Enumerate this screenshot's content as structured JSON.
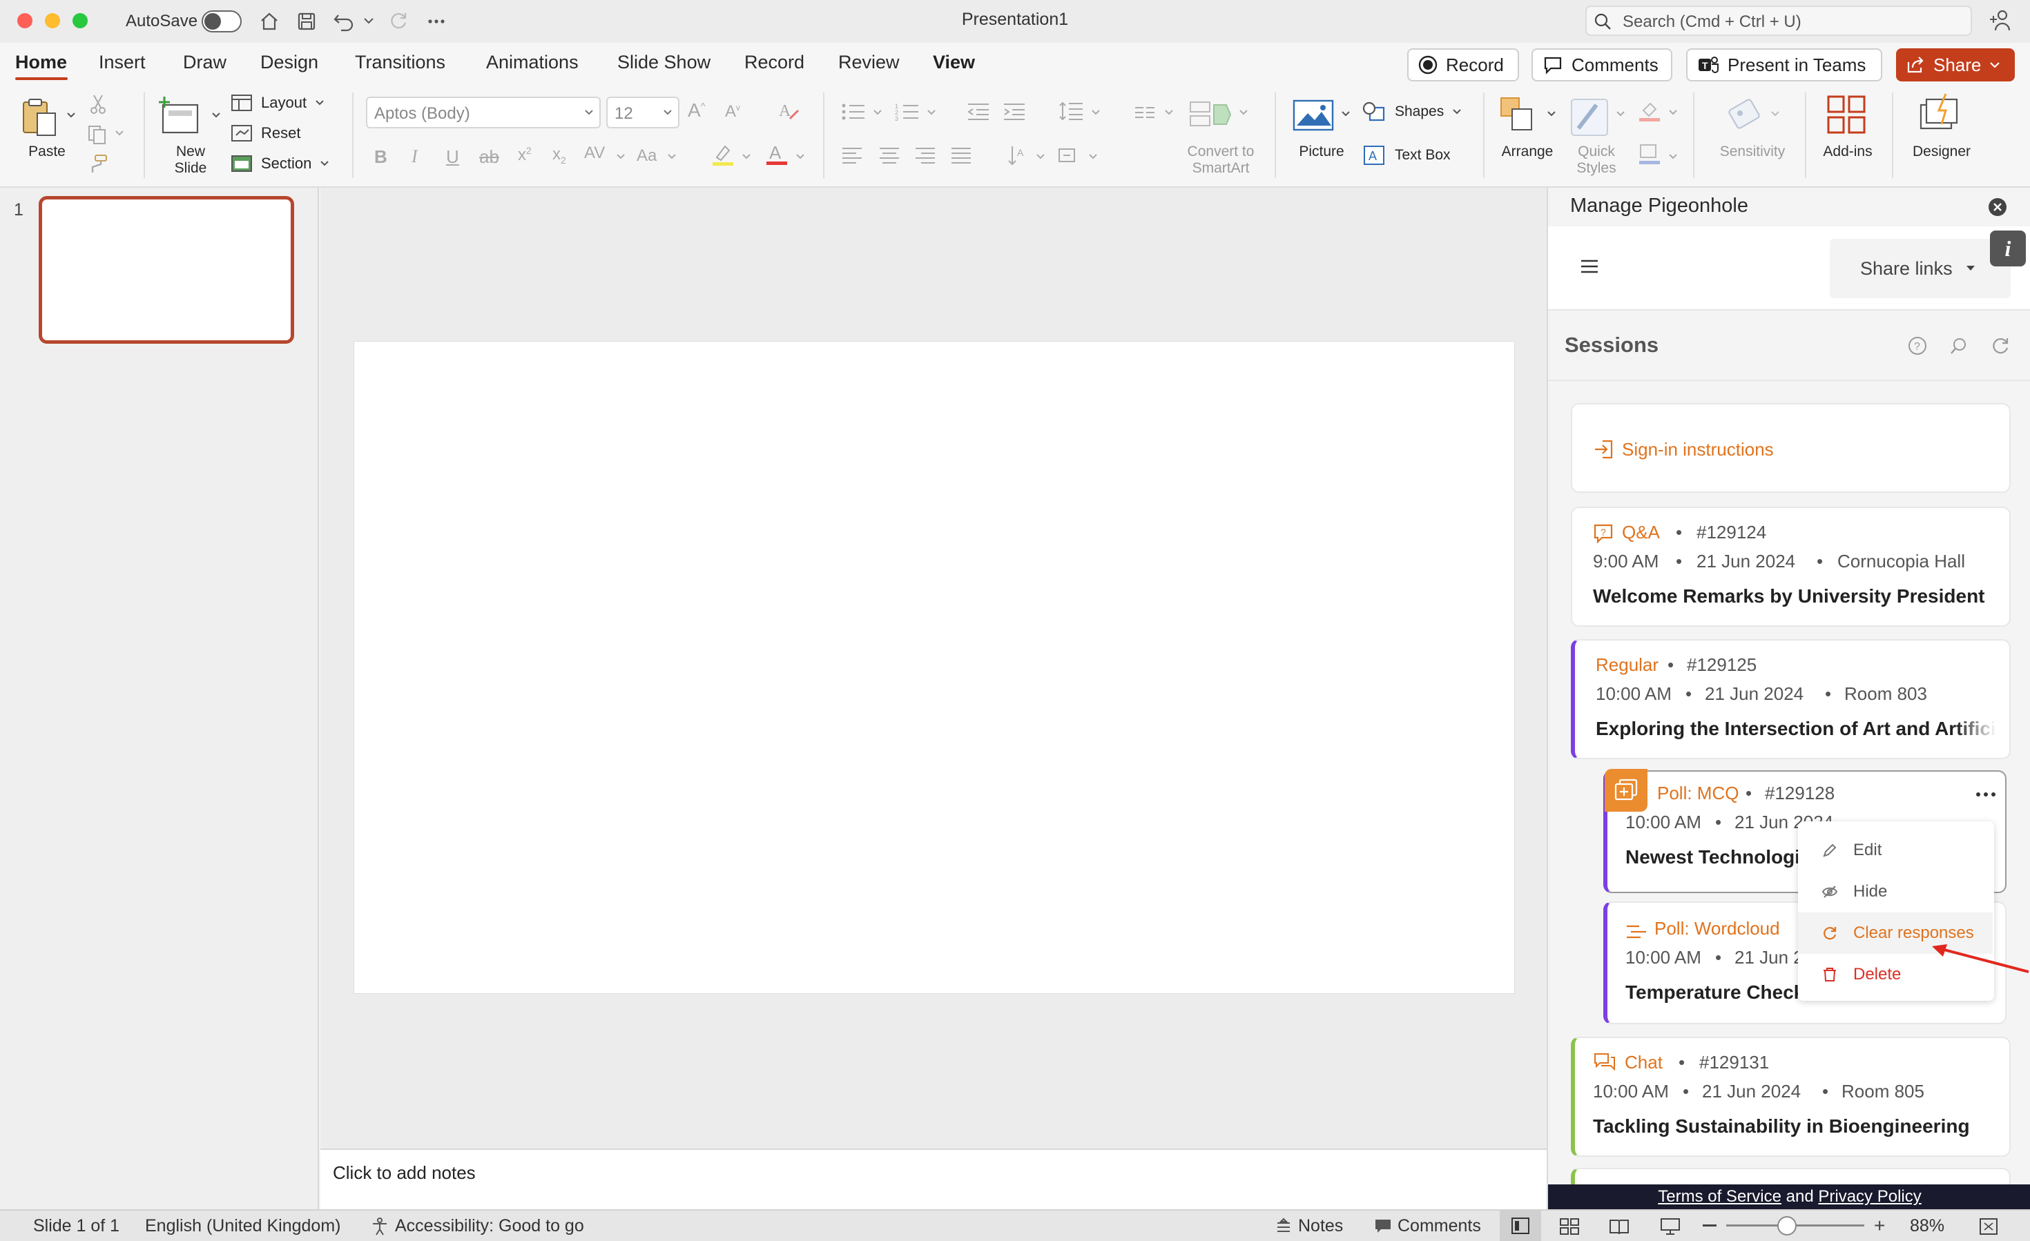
{
  "window": {
    "title": "Presentation1",
    "autosave_label": "AutoSave",
    "search_placeholder": "Search (Cmd + Ctrl + U)"
  },
  "tabs": [
    "Home",
    "Insert",
    "Draw",
    "Design",
    "Transitions",
    "Animations",
    "Slide Show",
    "Record",
    "Review",
    "View"
  ],
  "top_buttons": {
    "record": "Record",
    "comments": "Comments",
    "present": "Present in Teams",
    "share": "Share"
  },
  "ribbon": {
    "paste": "Paste",
    "new_slide_1": "New",
    "new_slide_2": "Slide",
    "layout": "Layout",
    "reset": "Reset",
    "section": "Section",
    "font_name": "Aptos (Body)",
    "font_size": "12",
    "convert_1": "Convert to",
    "convert_2": "SmartArt",
    "picture": "Picture",
    "shapes": "Shapes",
    "text_box": "Text Box",
    "arrange": "Arrange",
    "quick_1": "Quick",
    "quick_2": "Styles",
    "sensitivity": "Sensitivity",
    "addins": "Add-ins",
    "designer": "Designer",
    "accent_color": "#c43e1c"
  },
  "thumbnails": {
    "number": "1"
  },
  "notes_placeholder": "Click to add notes",
  "panel": {
    "title": "Manage Pigeonhole",
    "share_links": "Share links",
    "sessions_heading": "Sessions",
    "sign_in": "Sign-in instructions",
    "sessions": [
      {
        "type": "Q&A",
        "id": "#129124",
        "time": "9:00 AM",
        "date": "21 Jun 2024",
        "place": "Cornucopia Hall",
        "title": "Welcome Remarks by University President",
        "accent": "#ffffff"
      },
      {
        "type": "Regular",
        "id": "#129125",
        "time": "10:00 AM",
        "date": "21 Jun 2024",
        "place": "Room 803",
        "title": "Exploring the Intersection of Art and Artificial Intelligence",
        "accent": "#7b3fe4"
      },
      {
        "type": "Poll: MCQ",
        "id": "#129128",
        "time": "10:00 AM",
        "date": "21 Jun 2024",
        "title": "Newest Technologies",
        "accent": "#7b3fe4"
      },
      {
        "type": "Poll: Wordcloud",
        "id": "",
        "time": "10:00 AM",
        "date": "21 Jun 2024",
        "title": "Temperature Check",
        "accent": "#7b3fe4"
      },
      {
        "type": "Chat",
        "id": "#129131",
        "time": "10:00 AM",
        "date": "21 Jun 2024",
        "place": "Room 805",
        "title": "Tackling Sustainability in Bioengineering",
        "accent": "#8bc34a"
      }
    ],
    "menu": {
      "edit": "Edit",
      "hide": "Hide",
      "clear": "Clear responses",
      "delete": "Delete"
    },
    "footer": {
      "terms": "Terms of Service",
      "and": "and",
      "privacy": "Privacy Policy"
    }
  },
  "status": {
    "slide": "Slide 1 of 1",
    "language": "English (United Kingdom)",
    "accessibility": "Accessibility: Good to go",
    "notes": "Notes",
    "comments": "Comments",
    "zoom": "88%"
  }
}
